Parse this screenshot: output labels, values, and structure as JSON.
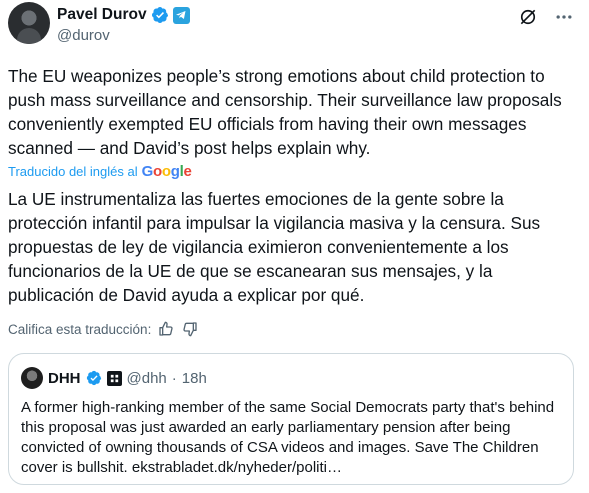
{
  "author": {
    "name": "Pavel Durov",
    "handle": "@durov"
  },
  "tweet": {
    "text": "The EU weaponizes people’s strong emotions about child protection to push mass surveillance and censorship. Their surveillance law proposals conveniently exempted EU officials from having their own messages scanned — and David’s post helps explain why."
  },
  "translation": {
    "label": "Traducido del inglés al",
    "provider_letters": [
      "G",
      "o",
      "o",
      "g",
      "l",
      "e"
    ],
    "text": "La UE instrumentaliza las fuertes emociones de la gente sobre la protección infantil para impulsar la vigilancia masiva y la censura. Sus propuestas de ley de vigilancia eximieron convenientemente a los funcionarios de la UE de que se escanearan sus mensajes, y la publicación de David ayuda a explicar por qué.",
    "rate_label": "Califica esta traducción:"
  },
  "quote": {
    "name": "DHH",
    "handle": "@dhh",
    "separator": "·",
    "time": "18h",
    "text": "A former high-ranking member of the same Social Democrats party that's behind this proposal was just awarded an early parliamentary pension after being convicted of owning thousands of CSA videos and images. Save The Children cover is bullshit. ekstrabladet.dk/nyheder/politi…"
  },
  "icons": {
    "verified": "verified-check-icon",
    "telegram": "telegram-affiliate-icon",
    "grok": "grok-icon",
    "more": "more-options-icon",
    "thumbs_up": "thumbs-up-icon",
    "thumbs_down": "thumbs-down-icon"
  },
  "colors": {
    "accent": "#1d9bf0",
    "text": "#0f1419",
    "muted": "#536471",
    "border": "#cfd9de"
  }
}
